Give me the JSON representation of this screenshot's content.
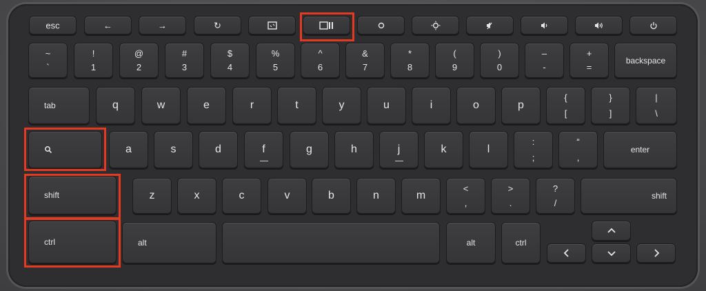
{
  "keyboard": {
    "function_row": {
      "esc": "esc",
      "back": "←",
      "forward": "→",
      "refresh": "↻",
      "mute": "🔇"
    },
    "number_row": [
      {
        "top": "~",
        "bottom": "`"
      },
      {
        "top": "!",
        "bottom": "1"
      },
      {
        "top": "@",
        "bottom": "2"
      },
      {
        "top": "#",
        "bottom": "3"
      },
      {
        "top": "$",
        "bottom": "4"
      },
      {
        "top": "%",
        "bottom": "5"
      },
      {
        "top": "^",
        "bottom": "6"
      },
      {
        "top": "&",
        "bottom": "7"
      },
      {
        "top": "*",
        "bottom": "8"
      },
      {
        "top": "(",
        "bottom": "9"
      },
      {
        "top": ")",
        "bottom": "0"
      },
      {
        "top": "–",
        "bottom": "-"
      },
      {
        "top": "+",
        "bottom": "="
      },
      {
        "label": "backspace"
      }
    ],
    "top_row": {
      "tab": "tab",
      "letters": [
        "q",
        "w",
        "e",
        "r",
        "t",
        "y",
        "u",
        "i",
        "o",
        "p"
      ],
      "brace_top": "{",
      "brace_bottom": "[",
      "rbrace_top": "}",
      "rbrace_bottom": "]",
      "pipe_top": "|",
      "pipe_bottom": "\\"
    },
    "home_row": {
      "letters": [
        "a",
        "s",
        "d",
        "f",
        "g",
        "h",
        "j",
        "k",
        "l"
      ],
      "semi_top": ":",
      "semi_bottom": ";",
      "quote_top": "“",
      "quote_bottom": ",",
      "enter": "enter"
    },
    "shift_row": {
      "shift_left": "shift",
      "letters": [
        "z",
        "x",
        "c",
        "v",
        "b",
        "n",
        "m"
      ],
      "lt_top": "<",
      "lt_bottom": ",",
      "gt_top": ">",
      "gt_bottom": ".",
      "q_top": "?",
      "q_bottom": "/",
      "shift_right": "shift"
    },
    "bottom_row": {
      "ctrl_left": "ctrl",
      "alt_left": "alt",
      "alt_right": "alt",
      "ctrl_right": "ctrl"
    },
    "highlight_color": "#e53a22"
  }
}
